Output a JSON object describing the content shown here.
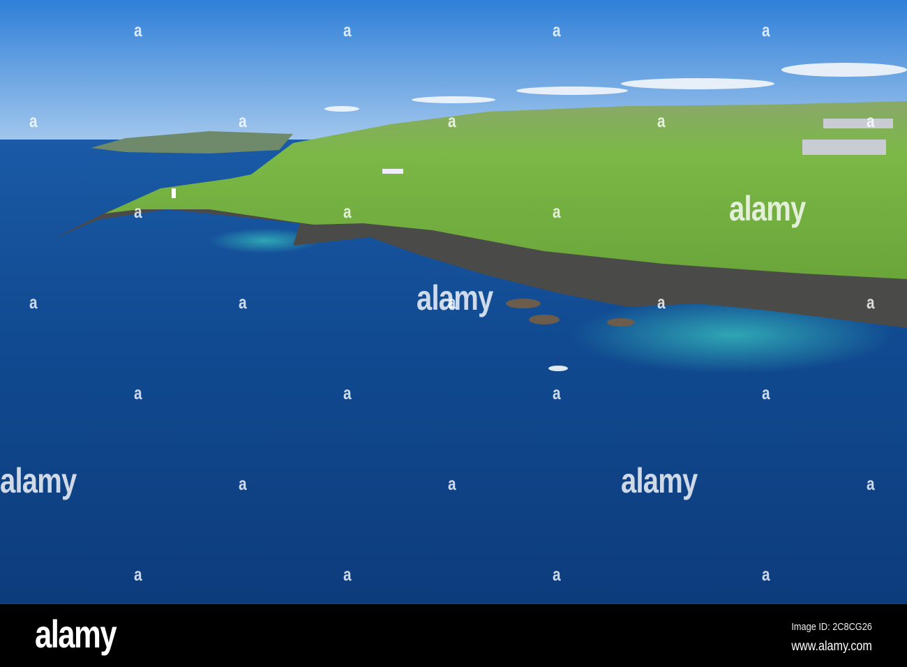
{
  "image": {
    "description_free": true,
    "colors": {
      "sky_top": "#2f7fd8",
      "sky_bottom": "#a9cbee",
      "sea_deep": "#0d3c7c",
      "sea_mid": "#114b92",
      "turquoise": "#2a9bb0",
      "land": "#6fae3a",
      "cliff": "#4a4a48"
    }
  },
  "watermark": {
    "text": "alamy",
    "small_mark": "a"
  },
  "footer": {
    "logo": "alamy",
    "image_id": "Image ID: 2C8CG26",
    "url": "www.alamy.com"
  }
}
